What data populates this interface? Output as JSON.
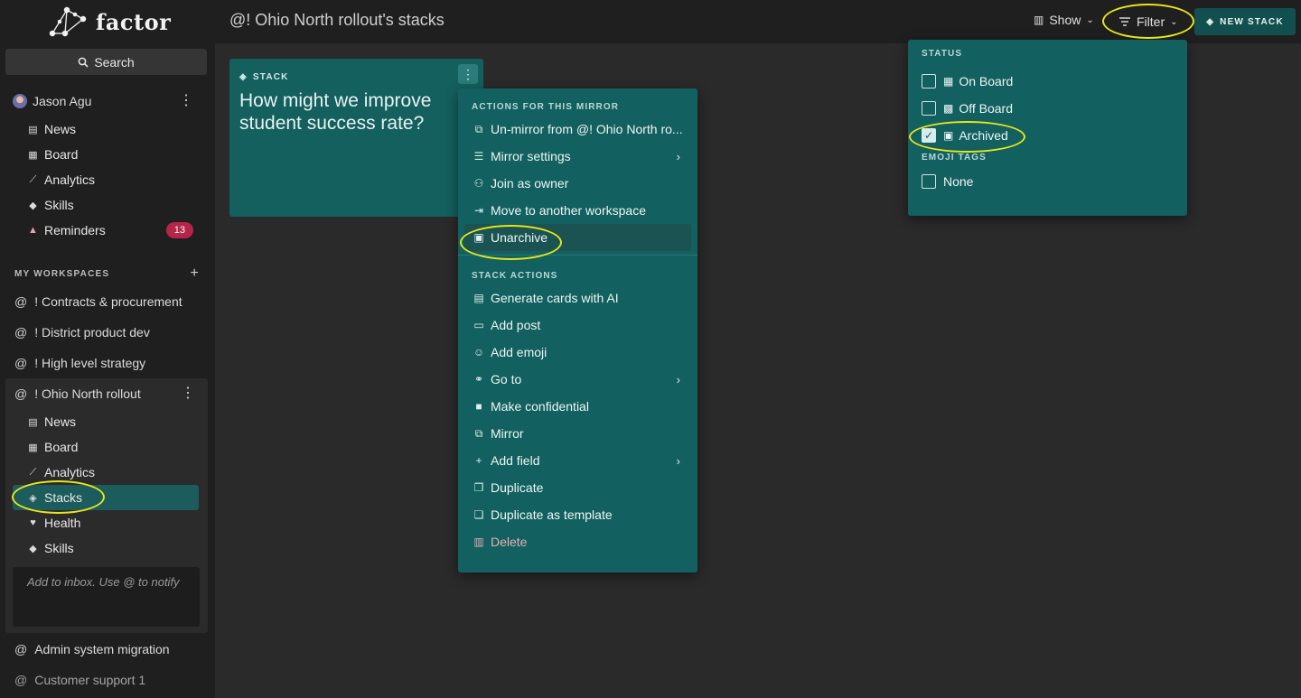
{
  "brand": {
    "name": "factor"
  },
  "sidebar": {
    "search_label": "Search",
    "user": {
      "name": "Jason Agu"
    },
    "personal_nav": [
      {
        "label": "News",
        "icon": "news-icon"
      },
      {
        "label": "Board",
        "icon": "board-icon"
      },
      {
        "label": "Analytics",
        "icon": "analytics-icon"
      },
      {
        "label": "Skills",
        "icon": "skills-icon"
      },
      {
        "label": "Reminders",
        "icon": "bell-icon",
        "badge": "13"
      }
    ],
    "workspaces_label": "MY WORKSPACES",
    "workspaces": [
      {
        "label": "! Contracts & procurement"
      },
      {
        "label": "! District product dev"
      },
      {
        "label": "! High level strategy"
      }
    ],
    "active_workspace": {
      "label": "! Ohio North rollout",
      "nav": [
        {
          "label": "News",
          "icon": "news-icon"
        },
        {
          "label": "Board",
          "icon": "board-icon"
        },
        {
          "label": "Analytics",
          "icon": "analytics-icon"
        },
        {
          "label": "Stacks",
          "icon": "stacks-icon",
          "active": true
        },
        {
          "label": "Health",
          "icon": "health-icon"
        },
        {
          "label": "Skills",
          "icon": "skills-icon"
        }
      ],
      "inbox_placeholder": "Add to inbox. Use @ to notify"
    },
    "more_workspaces": [
      {
        "label": "Admin system migration"
      },
      {
        "label": "Customer support 1"
      }
    ]
  },
  "topbar": {
    "title": "! Ohio North rollout's stacks",
    "show_label": "Show",
    "filter_label": "Filter",
    "new_stack_label": "NEW STACK"
  },
  "card": {
    "tag": "STACK",
    "title": "How might we improve student success rate?"
  },
  "context_menu": {
    "section1_title": "ACTIONS FOR THIS MIRROR",
    "section1": [
      {
        "label": "Un-mirror from @! Ohio North ro...",
        "icon": "unmirror-icon"
      },
      {
        "label": "Mirror settings",
        "icon": "sliders-icon",
        "submenu": true
      },
      {
        "label": "Join as owner",
        "icon": "users-icon"
      },
      {
        "label": "Move to another workspace",
        "icon": "move-icon"
      },
      {
        "label": "Unarchive",
        "icon": "unarchive-icon",
        "highlighted": true
      }
    ],
    "section2_title": "STACK ACTIONS",
    "section2": [
      {
        "label": "Generate cards with AI",
        "icon": "ai-cards-icon"
      },
      {
        "label": "Add post",
        "icon": "post-icon"
      },
      {
        "label": "Add emoji",
        "icon": "emoji-icon"
      },
      {
        "label": "Go to",
        "icon": "link-icon",
        "submenu": true
      },
      {
        "label": "Make confidential",
        "icon": "lock-icon"
      },
      {
        "label": "Mirror",
        "icon": "mirror-icon"
      },
      {
        "label": "Add field",
        "icon": "plus-icon",
        "submenu": true
      },
      {
        "label": "Duplicate",
        "icon": "duplicate-icon"
      },
      {
        "label": "Duplicate as template",
        "icon": "template-icon"
      },
      {
        "label": "Delete",
        "icon": "trash-icon",
        "danger": true
      }
    ]
  },
  "filter_panel": {
    "status_title": "STATUS",
    "status": [
      {
        "label": "On Board",
        "checked": false
      },
      {
        "label": "Off Board",
        "checked": false
      },
      {
        "label": "Archived",
        "checked": true
      }
    ],
    "emoji_title": "EMOJI TAGS",
    "emoji": [
      {
        "label": "None",
        "checked": false
      }
    ]
  },
  "colors": {
    "teal_panel": "#12605f",
    "active_nav": "#1d5c5c",
    "highlight_ring": "#e9e51a",
    "badge": "#b5254a"
  }
}
